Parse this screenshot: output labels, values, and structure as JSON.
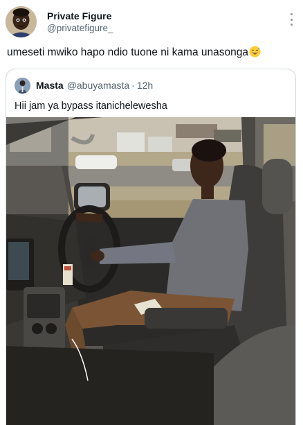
{
  "tweet": {
    "author": {
      "display_name": "Private Figure",
      "handle": "@privatefigure_",
      "avatar_icon": "profile-avatar"
    },
    "more_icon": "more-vertical-icon",
    "text": "umeseti mwiko hapo ndio tuone ni kama unasonga",
    "emoji": "grinning-sweat-emoji"
  },
  "quoted_tweet": {
    "author": {
      "display_name": "Masta",
      "handle": "@abuyamasta",
      "avatar_icon": "profile-avatar"
    },
    "separator": "·",
    "time": "12h",
    "text": "Hii jam ya bypass itanichelewesha",
    "image_description_icon": "photo-man-driving-car"
  },
  "colors": {
    "text": "#0f1419",
    "secondary": "#536471",
    "border": "#cfd9de"
  }
}
